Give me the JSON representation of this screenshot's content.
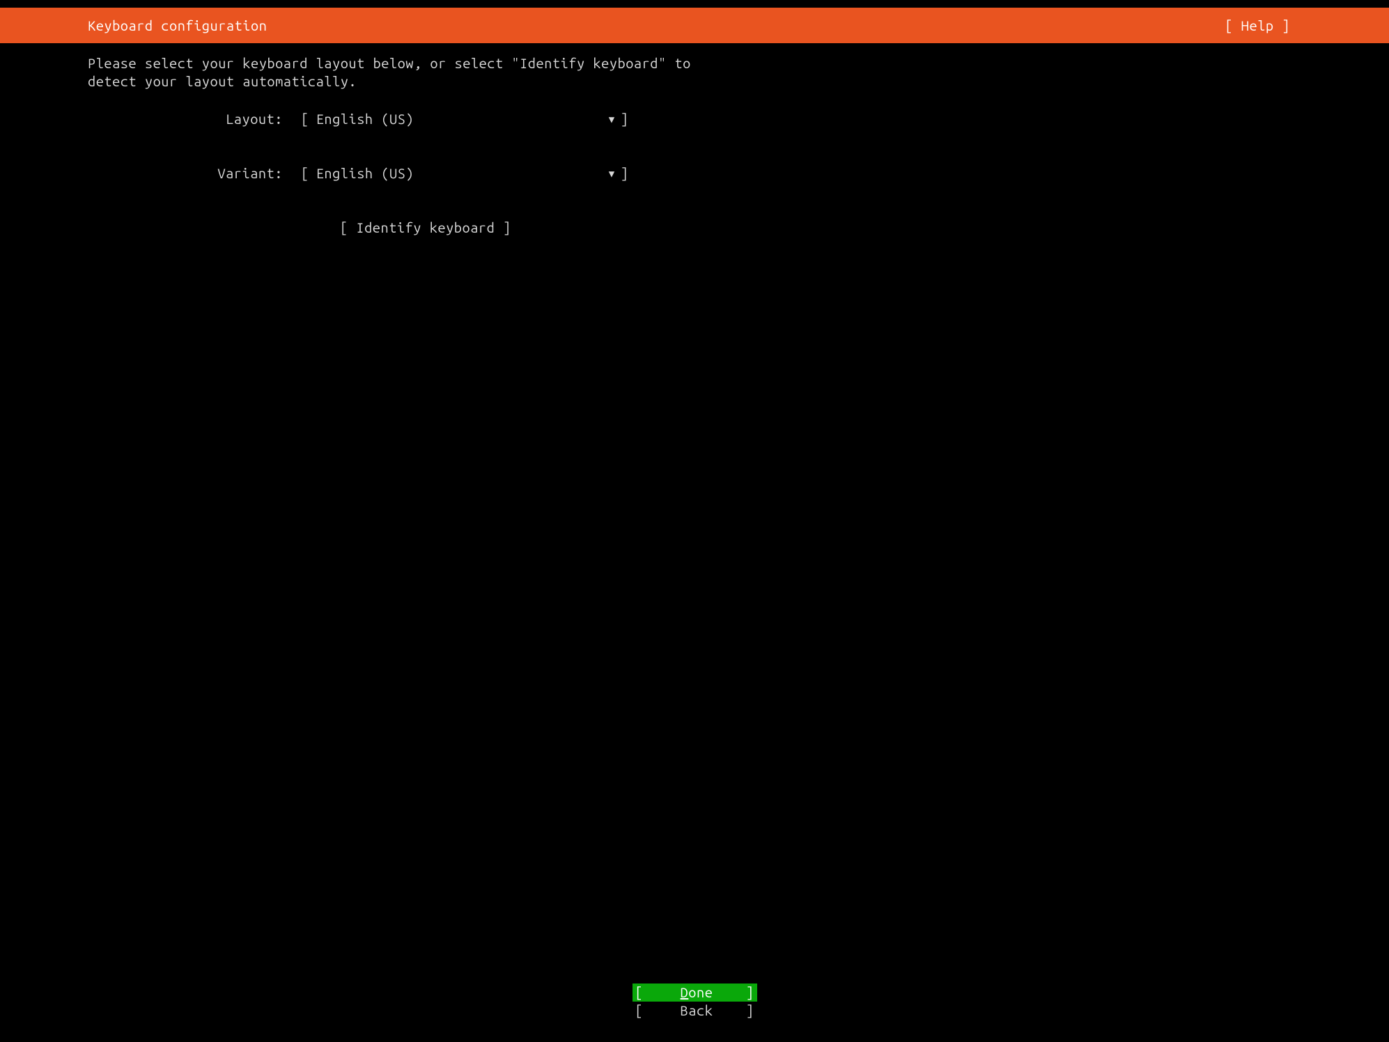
{
  "colors": {
    "header_bg": "#e95420",
    "selected_bg": "#0aa80a",
    "text": "#d8d8d8"
  },
  "header": {
    "title": "Keyboard configuration",
    "help_label": "[ Help ]"
  },
  "instructions": "Please select your keyboard layout below, or select \"Identify keyboard\" to\ndetect your layout automatically.",
  "fields": {
    "layout": {
      "label": "Layout:",
      "value": "English (US)"
    },
    "variant": {
      "label": "Variant:",
      "value": "English (US)"
    }
  },
  "identify_button": "[ Identify keyboard ]",
  "footer": {
    "done": "Done",
    "back": "Back"
  }
}
